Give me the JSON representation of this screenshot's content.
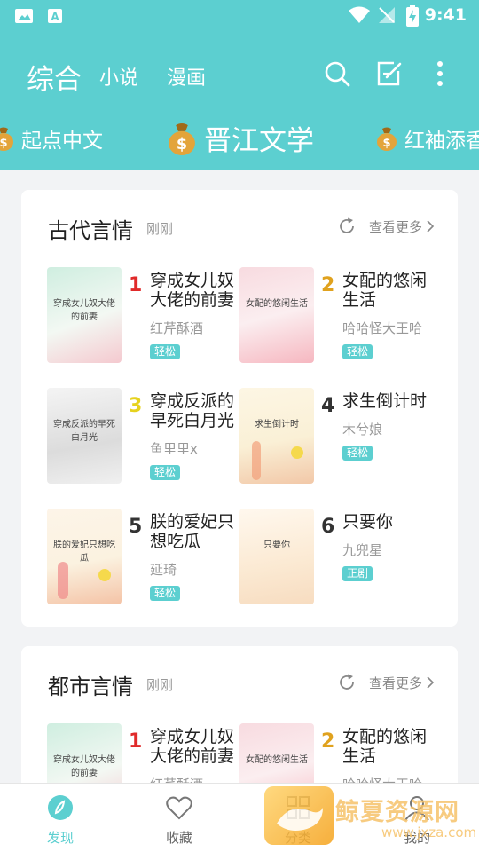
{
  "status_bar": {
    "time": "9:41"
  },
  "top_nav": {
    "tabs": [
      "综合",
      "小说",
      "漫画"
    ]
  },
  "sources": [
    "起点中文",
    "晋江文学",
    "红袖添香"
  ],
  "sections": [
    {
      "title": "古代言情",
      "updated": "刚刚",
      "more_label": "查看更多",
      "books": [
        {
          "rank": "1",
          "rank_color": "#e02a2a",
          "title": "穿成女儿奴大佬的前妻",
          "author": "红芹酥酒",
          "tag": "轻松",
          "cover_title": "穿成女儿奴大佬的前妻",
          "cover_author": "红芹酥酒"
        },
        {
          "rank": "2",
          "rank_color": "#e0a21e",
          "title": "女配的悠闲生活",
          "author": "哈哈怪大王哈",
          "tag": "轻松",
          "cover_title": "女配的悠闲生活",
          "cover_author": "哈哈怪大王哈"
        },
        {
          "rank": "3",
          "rank_color": "#e6d21e",
          "title": "穿成反派的早死白月光",
          "author": "鱼里里x",
          "tag": "轻松",
          "cover_title": "穿成反派的早死白月光",
          "cover_author": "鱼里里x"
        },
        {
          "rank": "4",
          "rank_color": "#333333",
          "title": "求生倒计时",
          "author": "木兮娘",
          "tag": "轻松",
          "cover_title": "求生倒计时",
          "cover_author": "木兮娘"
        },
        {
          "rank": "5",
          "rank_color": "#333333",
          "title": "朕的爱妃只想吃瓜",
          "author": "延琦",
          "tag": "轻松",
          "cover_title": "朕的爱妃只想吃瓜",
          "cover_author": "延琦"
        },
        {
          "rank": "6",
          "rank_color": "#333333",
          "title": "只要你",
          "author": "九兜星",
          "tag": "正剧",
          "cover_title": "只要你",
          "cover_author": "九兜星"
        }
      ]
    },
    {
      "title": "都市言情",
      "updated": "刚刚",
      "more_label": "查看更多",
      "books": [
        {
          "rank": "1",
          "rank_color": "#e02a2a",
          "title": "穿成女儿奴大佬的前妻",
          "author": "红芹酥酒",
          "cover_title": "穿成女儿奴大佬的前妻"
        },
        {
          "rank": "2",
          "rank_color": "#e0a21e",
          "title": "女配的悠闲生活",
          "author": "哈哈怪大王哈",
          "cover_title": "女配的悠闲生活"
        }
      ]
    }
  ],
  "bottom_nav": {
    "items": [
      {
        "label": "发现",
        "icon": "discover-icon"
      },
      {
        "label": "收藏",
        "icon": "heart-icon"
      },
      {
        "label": "分类",
        "icon": "category-icon"
      },
      {
        "label": "我的",
        "icon": "user-icon"
      }
    ]
  },
  "watermark": {
    "text": "鲸夏资源网",
    "url": "www.jxza.com"
  },
  "colors": {
    "accent": "#5ccfd0",
    "rank1": "#e02a2a",
    "rank2": "#e0a21e",
    "rank3": "#e6d21e"
  }
}
